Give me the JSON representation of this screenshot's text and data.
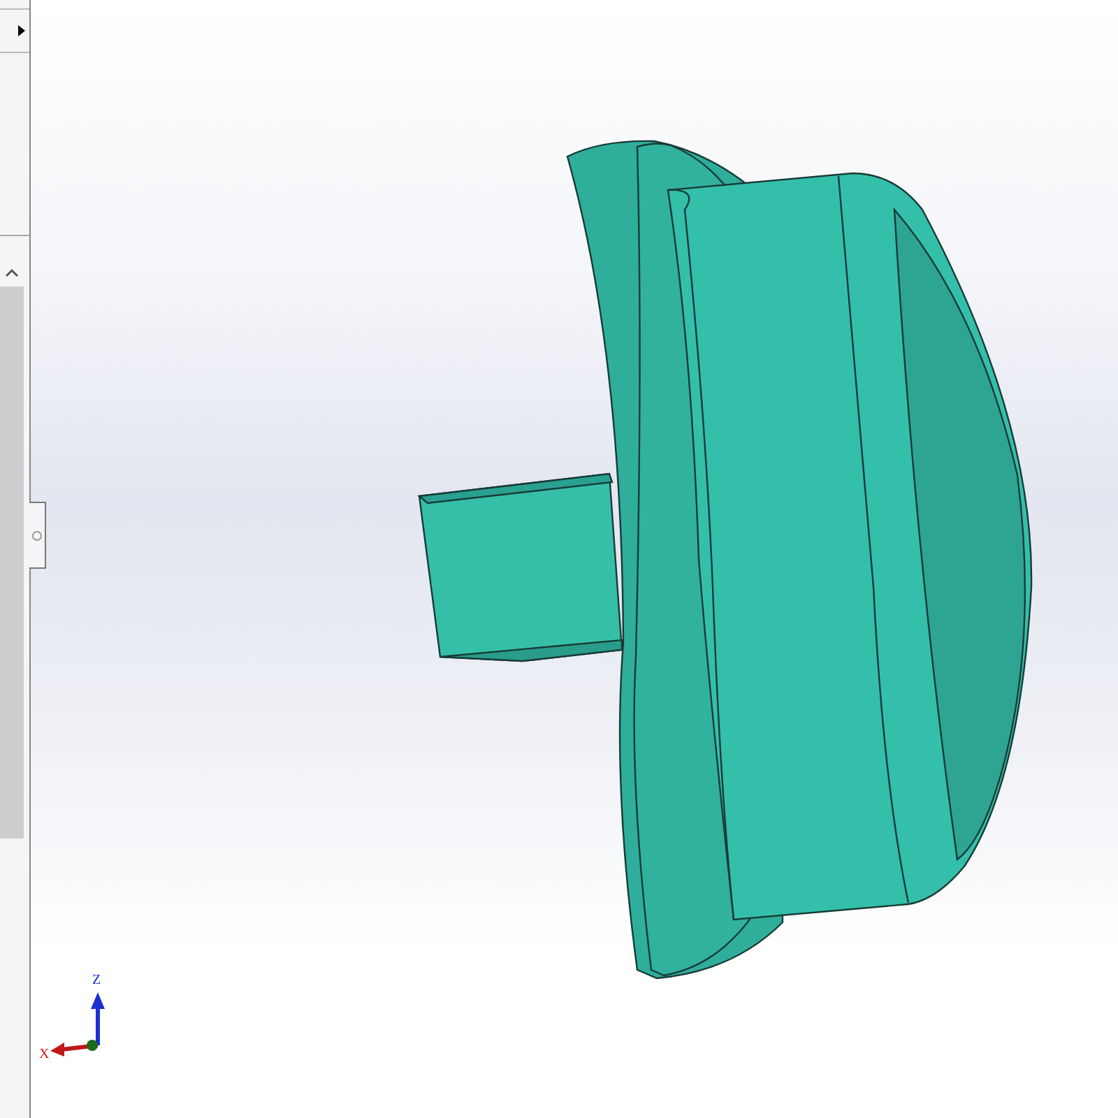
{
  "viewport": {
    "triad": {
      "x_label": "X",
      "z_label": "Z"
    }
  }
}
